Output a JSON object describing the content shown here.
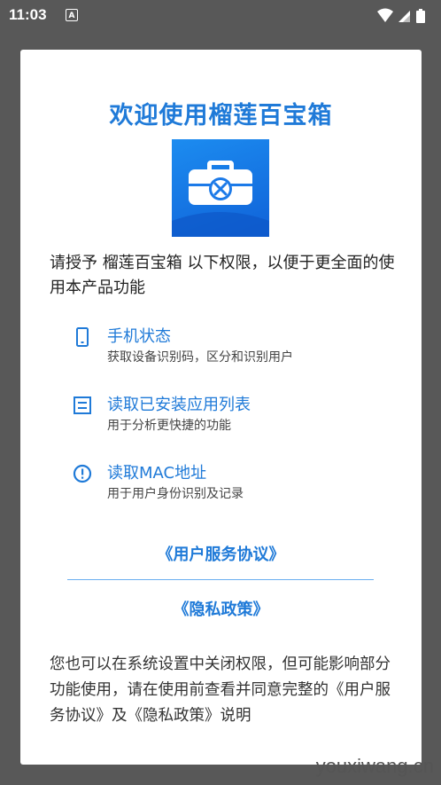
{
  "status_bar": {
    "time": "11:03",
    "notification_icon": "a-icon",
    "system_icons": [
      "wifi-icon",
      "signal-icon",
      "battery-icon"
    ]
  },
  "dialog": {
    "title": "欢迎使用榴莲百宝箱",
    "app_icon": "toolbox-icon",
    "intro": "请授予 榴莲百宝箱 以下权限，以便于更全面的使用本产品功能",
    "permissions": [
      {
        "icon": "phone-icon",
        "title": "手机状态",
        "desc": "获取设备识别码，区分和识别用户"
      },
      {
        "icon": "list-icon",
        "title": "读取已安装应用列表",
        "desc": "用于分析更快捷的功能"
      },
      {
        "icon": "info-icon",
        "title": "读取MAC地址",
        "desc": "用于用户身份识别及记录"
      }
    ],
    "user_agreement_link": "《用户服务协议》",
    "privacy_policy_link": "《隐私政策》",
    "footer": "您也可以在系统设置中关闭权限，但可能影响部分功能使用，请在使用前查看并同意完整的《用户服务协议》及《隐私政策》说明"
  },
  "watermark": "youxiwang.cn",
  "colors": {
    "accent": "#1f7ad8",
    "background_dim": "#585858"
  }
}
